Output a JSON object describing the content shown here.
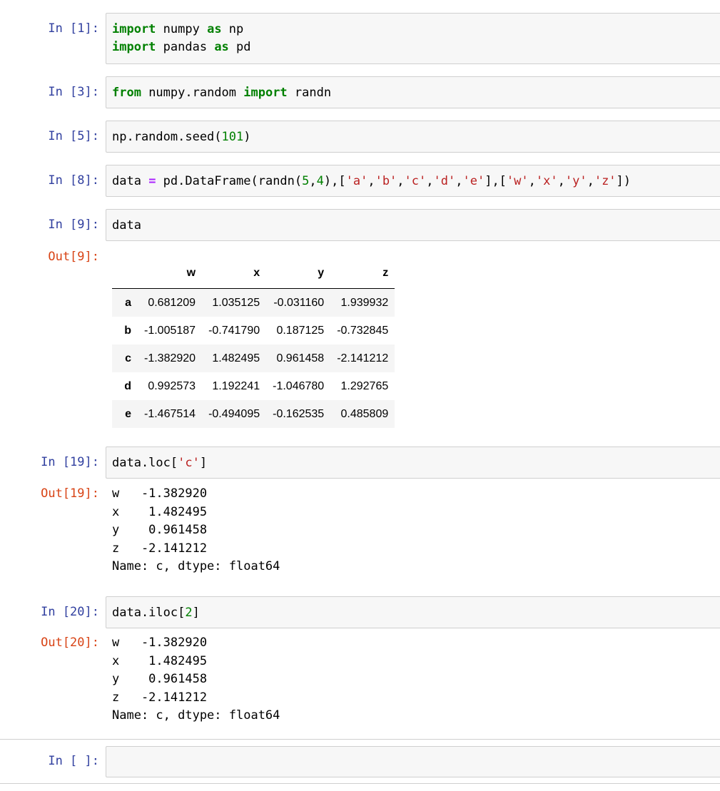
{
  "cells": [
    {
      "prompt": "In [1]:",
      "lines": [
        [
          {
            "t": "import",
            "c": "kw"
          },
          {
            "t": " numpy ",
            "c": ""
          },
          {
            "t": "as",
            "c": "kw"
          },
          {
            "t": " np",
            "c": ""
          }
        ],
        [
          {
            "t": "import",
            "c": "kw"
          },
          {
            "t": " pandas ",
            "c": ""
          },
          {
            "t": "as",
            "c": "kw"
          },
          {
            "t": " pd",
            "c": ""
          }
        ]
      ]
    },
    {
      "prompt": "In [3]:",
      "lines": [
        [
          {
            "t": "from",
            "c": "kw"
          },
          {
            "t": " numpy.random ",
            "c": ""
          },
          {
            "t": "import",
            "c": "kw"
          },
          {
            "t": " randn",
            "c": ""
          }
        ]
      ]
    },
    {
      "prompt": "In [5]:",
      "lines": [
        [
          {
            "t": "np.random.seed(",
            "c": ""
          },
          {
            "t": "101",
            "c": "num"
          },
          {
            "t": ")",
            "c": ""
          }
        ]
      ]
    },
    {
      "prompt": "In [8]:",
      "lines": [
        [
          {
            "t": "data ",
            "c": ""
          },
          {
            "t": "=",
            "c": "op"
          },
          {
            "t": " pd.DataFrame(randn(",
            "c": ""
          },
          {
            "t": "5",
            "c": "num"
          },
          {
            "t": ",",
            "c": ""
          },
          {
            "t": "4",
            "c": "num"
          },
          {
            "t": "),[",
            "c": ""
          },
          {
            "t": "'a'",
            "c": "str"
          },
          {
            "t": ",",
            "c": ""
          },
          {
            "t": "'b'",
            "c": "str"
          },
          {
            "t": ",",
            "c": ""
          },
          {
            "t": "'c'",
            "c": "str"
          },
          {
            "t": ",",
            "c": ""
          },
          {
            "t": "'d'",
            "c": "str"
          },
          {
            "t": ",",
            "c": ""
          },
          {
            "t": "'e'",
            "c": "str"
          },
          {
            "t": "],[",
            "c": ""
          },
          {
            "t": "'w'",
            "c": "str"
          },
          {
            "t": ",",
            "c": ""
          },
          {
            "t": "'x'",
            "c": "str"
          },
          {
            "t": ",",
            "c": ""
          },
          {
            "t": "'y'",
            "c": "str"
          },
          {
            "t": ",",
            "c": ""
          },
          {
            "t": "'z'",
            "c": "str"
          },
          {
            "t": "])",
            "c": ""
          }
        ]
      ]
    },
    {
      "prompt": "In [9]:",
      "lines": [
        [
          {
            "t": "data",
            "c": ""
          }
        ]
      ]
    },
    {
      "prompt": "In [19]:",
      "lines": [
        [
          {
            "t": "data.loc[",
            "c": ""
          },
          {
            "t": "'c'",
            "c": "str"
          },
          {
            "t": "]",
            "c": ""
          }
        ]
      ]
    },
    {
      "prompt": "In [20]:",
      "lines": [
        [
          {
            "t": "data.iloc[",
            "c": ""
          },
          {
            "t": "2",
            "c": "num"
          },
          {
            "t": "]",
            "c": ""
          }
        ]
      ]
    },
    {
      "prompt": "In [ ]:",
      "lines": []
    }
  ],
  "out9": {
    "prompt": "Out[9]:",
    "columns": [
      "",
      "w",
      "x",
      "y",
      "z"
    ],
    "rows": [
      {
        "idx": "a",
        "vals": [
          "0.681209",
          "1.035125",
          "-0.031160",
          "1.939932"
        ]
      },
      {
        "idx": "b",
        "vals": [
          "-1.005187",
          "-0.741790",
          "0.187125",
          "-0.732845"
        ]
      },
      {
        "idx": "c",
        "vals": [
          "-1.382920",
          "1.482495",
          "0.961458",
          "-2.141212"
        ]
      },
      {
        "idx": "d",
        "vals": [
          "0.992573",
          "1.192241",
          "-1.046780",
          "1.292765"
        ]
      },
      {
        "idx": "e",
        "vals": [
          "-1.467514",
          "-0.494095",
          "-0.162535",
          "0.485809"
        ]
      }
    ]
  },
  "out19": {
    "prompt": "Out[19]:",
    "text": "w   -1.382920\nx    1.482495\ny    0.961458\nz   -2.141212\nName: c, dtype: float64"
  },
  "out20": {
    "prompt": "Out[20]:",
    "text": "w   -1.382920\nx    1.482495\ny    0.961458\nz   -2.141212\nName: c, dtype: float64"
  }
}
